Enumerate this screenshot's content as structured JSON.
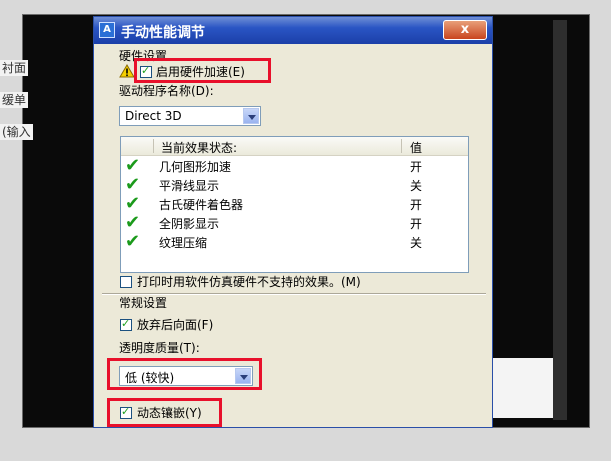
{
  "background": {
    "left_fragments": [
      "衬面",
      "缓单",
      "(输入"
    ]
  },
  "dialog": {
    "title": "手动性能调节",
    "close_label": "x",
    "hardware_group_label": "硬件设置",
    "enable_hw_accel_label": "启用硬件加速(E)",
    "enable_hw_accel_checked": true,
    "driver_name_label": "驱动程序名称(D):",
    "driver_value": "Direct 3D",
    "effects_header": "当前效果状态:",
    "value_header": "值",
    "effects": [
      {
        "name": "几何图形加速",
        "value": "开"
      },
      {
        "name": "平滑线显示",
        "value": "关"
      },
      {
        "name": "古氏硬件着色器",
        "value": "开"
      },
      {
        "name": "全阴影显示",
        "value": "开"
      },
      {
        "name": "纹理压缩",
        "value": "关"
      }
    ],
    "emulate_label": "打印时用软件仿真硬件不支持的效果。(M)",
    "emulate_checked": false,
    "general_group_label": "常规设置",
    "discard_back_label": "放弃后向面(F)",
    "discard_back_checked": true,
    "transparency_label": "透明度质量(T):",
    "transparency_value": "低 (较快)",
    "dynamic_tessellation_label": "动态镶嵌(Y)",
    "dynamic_tessellation_checked": true
  },
  "colors": {
    "highlight": "#e8102b",
    "titlebar": "#2a55c4",
    "check_green": "#1b9a1b"
  }
}
